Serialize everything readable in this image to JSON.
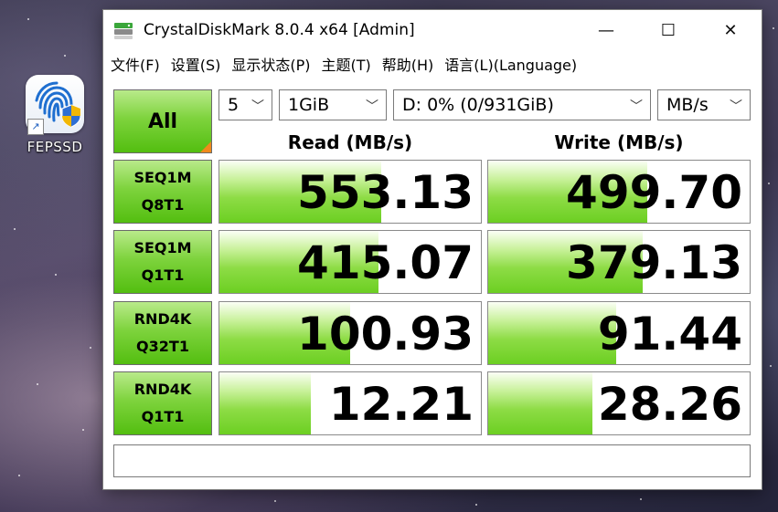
{
  "desktop": {
    "icon_label": "FEPSSD"
  },
  "window": {
    "title": "CrystalDiskMark 8.0.4 x64 [Admin]",
    "controls": {
      "minimize": "—",
      "maximize": "☐",
      "close": "✕"
    }
  },
  "menu": [
    "文件(F)",
    "设置(S)",
    "显示状态(P)",
    "主题(T)",
    "帮助(H)",
    "语言(L)(Language)"
  ],
  "toolbar": {
    "all_label": "All",
    "count": "5",
    "size": "1GiB",
    "drive": "D: 0% (0/931GiB)",
    "unit": "MB/s"
  },
  "headers": {
    "read": "Read (MB/s)",
    "write": "Write (MB/s)"
  },
  "tests": [
    {
      "line1": "SEQ1M",
      "line2": "Q8T1",
      "read": "553.13",
      "write": "499.70",
      "read_fill": 0.62,
      "write_fill": 0.61
    },
    {
      "line1": "SEQ1M",
      "line2": "Q1T1",
      "read": "415.07",
      "write": "379.13",
      "read_fill": 0.61,
      "write_fill": 0.59
    },
    {
      "line1": "RND4K",
      "line2": "Q32T1",
      "read": "100.93",
      "write": "91.44",
      "read_fill": 0.5,
      "write_fill": 0.49
    },
    {
      "line1": "RND4K",
      "line2": "Q1T1",
      "read": "12.21",
      "write": "28.26",
      "read_fill": 0.35,
      "write_fill": 0.4
    }
  ],
  "status_text": "",
  "colors": {
    "accent_green": "#6ccf22",
    "corner_orange": "#f08a1c"
  }
}
